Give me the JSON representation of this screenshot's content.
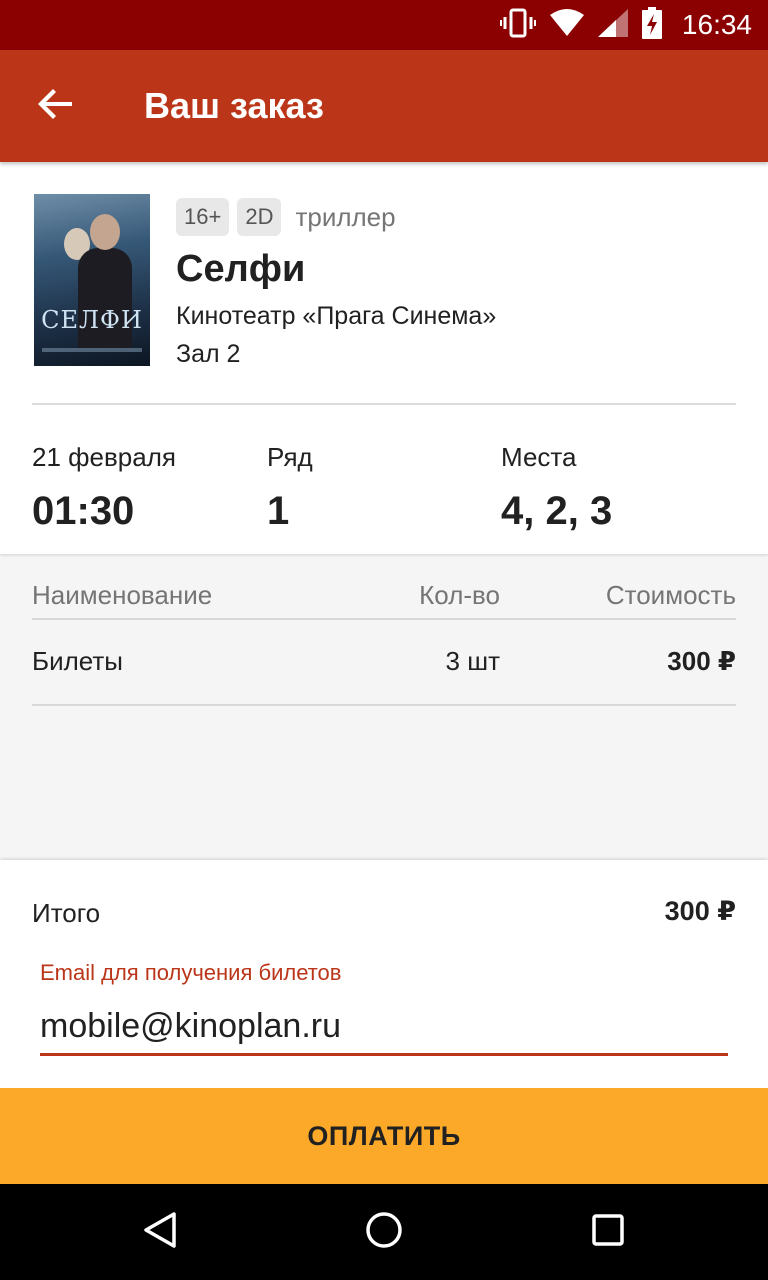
{
  "status_bar": {
    "time": "16:34"
  },
  "app_bar": {
    "title": "Ваш заказ"
  },
  "movie": {
    "age_rating": "16+",
    "format": "2D",
    "genre": "триллер",
    "title": "Селфи",
    "cinema": "Кинотеатр «Прага Синема»",
    "hall": "Зал 2",
    "poster_title": "СЕЛФИ"
  },
  "session": {
    "date_label": "21 февраля",
    "time": "01:30",
    "row_label": "Ряд",
    "row": "1",
    "seats_label": "Места",
    "seats": "4, 2, 3"
  },
  "order_table": {
    "headers": {
      "name": "Наименование",
      "qty": "Кол-во",
      "cost": "Стоимость"
    },
    "rows": [
      {
        "name": "Билеты",
        "qty": "3 шт",
        "cost": "300 ₽"
      }
    ]
  },
  "summary": {
    "total_label": "Итого",
    "total_value": "300 ₽",
    "email_label": "Email для получения билетов",
    "email_value": "mobile@kinoplan.ru"
  },
  "pay_button": {
    "label": "ОПЛАТИТЬ"
  },
  "colors": {
    "status_bar": "#8b0000",
    "app_bar": "#bb3619",
    "accent": "#bb3619",
    "pay_button": "#fca828"
  },
  "icons": [
    "vibrate-icon",
    "wifi-icon",
    "signal-icon",
    "battery-charging-icon",
    "back-arrow-icon",
    "nav-back-icon",
    "nav-home-icon",
    "nav-recents-icon"
  ]
}
